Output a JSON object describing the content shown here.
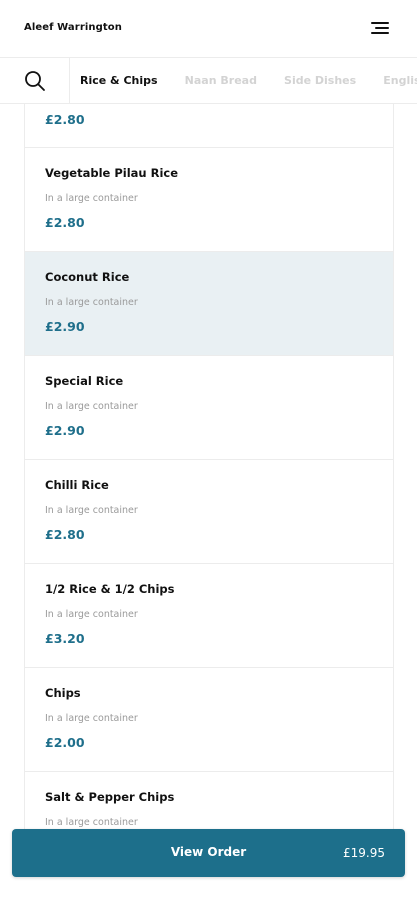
{
  "header": {
    "brand": "Aleef Warrington",
    "menu_icon": "hamburger-menu-icon"
  },
  "categories": {
    "search_icon": "search-icon",
    "tabs": [
      {
        "label": "Rice & Chips",
        "active": true
      },
      {
        "label": "Naan Bread",
        "active": false
      },
      {
        "label": "Side Dishes",
        "active": false
      },
      {
        "label": "English D",
        "active": false
      }
    ]
  },
  "items": [
    {
      "price": "£2.80"
    },
    {
      "name": "Vegetable Pilau Rice",
      "desc": "In a large container",
      "price": "£2.80"
    },
    {
      "name": "Coconut Rice",
      "desc": "In a large container",
      "price": "£2.90"
    },
    {
      "name": "Special Rice",
      "desc": "In a large container",
      "price": "£2.90"
    },
    {
      "name": "Chilli Rice",
      "desc": "In a large container",
      "price": "£2.80"
    },
    {
      "name": "1/2 Rice & 1/2 Chips",
      "desc": "In a large container",
      "price": "£3.20"
    },
    {
      "name": "Chips",
      "desc": "In a large container",
      "price": "£2.00"
    },
    {
      "name": "Salt & Pepper Chips",
      "desc": "In a large container",
      "price": ""
    }
  ],
  "order": {
    "label": "View Order",
    "total": "£19.95"
  },
  "colors": {
    "accent": "#1d6f8b",
    "price": "#1f6f8b",
    "highlight": "#e9f0f3",
    "inactive_tab": "#d3d3d3"
  }
}
